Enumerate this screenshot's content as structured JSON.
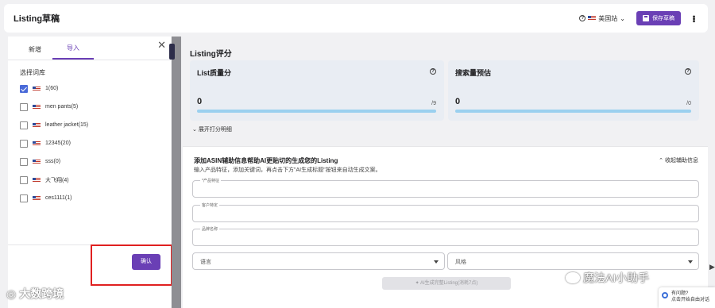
{
  "header": {
    "title": "Listing草稿",
    "marketplace": "美国站",
    "save_label": "保存草稿"
  },
  "left_panel": {
    "tabs": [
      {
        "label": "新增",
        "active": false
      },
      {
        "label": "导入",
        "active": true
      }
    ],
    "library_title": "选择词库",
    "libraries": [
      {
        "label": "1(60)",
        "checked": true
      },
      {
        "label": "men pants(5)",
        "checked": false
      },
      {
        "label": "leather jacket(15)",
        "checked": false
      },
      {
        "label": "12345(20)",
        "checked": false
      },
      {
        "label": "sss(0)",
        "checked": false
      },
      {
        "label": "大飞翔(4)",
        "checked": false
      },
      {
        "label": "ces1111(1)",
        "checked": false
      }
    ],
    "confirm_label": "确认"
  },
  "score": {
    "section_title": "Listing评分",
    "cards": [
      {
        "title": "List质量分",
        "value": "0",
        "max": "/9"
      },
      {
        "title": "搜索量预估",
        "value": "0",
        "max": "/0"
      }
    ],
    "expand_label": "展开打分明细"
  },
  "assist": {
    "title": "添加ASIN辅助信息帮助AI更贴切的生成您的Listing",
    "subtitle": "输入产品特征，添加关键词，再点击下方\"AI生成标题\"按钮来自动生成文案。",
    "collapse_label": "收起辅助信息",
    "fields": [
      {
        "label": "*产品特征"
      },
      {
        "label": "客户特定"
      },
      {
        "label": "品牌名称"
      }
    ],
    "selects": [
      {
        "placeholder": "语言"
      },
      {
        "placeholder": "风格"
      }
    ],
    "generate_label": "AI生成完整Listing(消耗7点)"
  },
  "overlays": {
    "watermark_left": "大数跨境",
    "watermark_right": "魔法AI小助手",
    "chat_line1": "有问题?",
    "chat_line2": "点击开始自由对话"
  },
  "colors": {
    "accent": "#6a3fb5",
    "progress": "#9ad0ef",
    "highlight_box": "#e02020"
  }
}
